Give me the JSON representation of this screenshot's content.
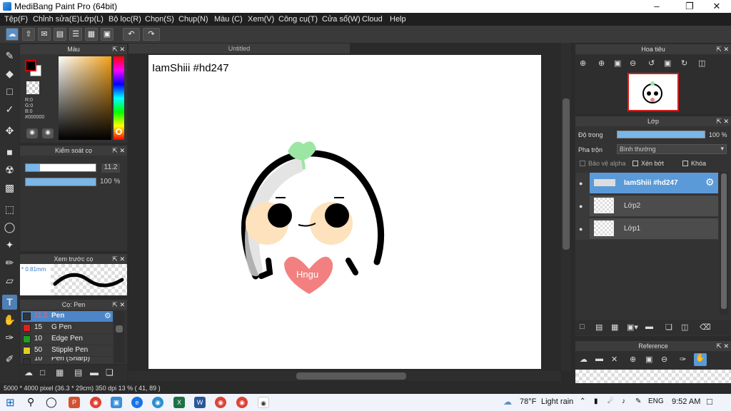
{
  "app": {
    "title": "MediBang Paint Pro (64bit)"
  },
  "menu": [
    "Tệp(F)",
    "Chỉnh sửa(E)",
    "Lớp(L)",
    "Bộ lọc(R)",
    "Chọn(S)",
    "Chụp(N)",
    "Màu (C)",
    "Xem(V)",
    "Công cụ(T)",
    "Cửa sổ(W)",
    "Cloud",
    "Help"
  ],
  "color_panel": {
    "title": "Màu",
    "r": "R:0",
    "g": "G:0",
    "b": "B:0",
    "hex": "#000000",
    "fg": "#000000",
    "bg": "#ffffff"
  },
  "brush_control": {
    "title": "Kiểm soát cọ",
    "size": "11.2",
    "opacity": "100 %",
    "size_fraction": 0.2,
    "opacity_fraction": 1.0
  },
  "brush_preview": {
    "title": "Xem trước cọ",
    "size_label": "* 0.81mm"
  },
  "brush_list": {
    "title": "Cọ: Pen",
    "items": [
      {
        "size": "11.2",
        "name": "Pen",
        "color": "#222222",
        "selected": true
      },
      {
        "size": "15",
        "name": "G Pen",
        "color": "#e02020",
        "selected": false
      },
      {
        "size": "10",
        "name": "Edge Pen",
        "color": "#20a020",
        "selected": false
      },
      {
        "size": "50",
        "name": "Stipple Pen",
        "color": "#e0d020",
        "selected": false
      },
      {
        "size": "10",
        "name": "Pen (Sharp)",
        "color": "#222222",
        "selected": false
      }
    ]
  },
  "canvas": {
    "tab": "Untitled",
    "text": "IamShiii #hd247",
    "heart_text": "Hngu"
  },
  "navigator": {
    "title": "Hoa tiêu"
  },
  "layers": {
    "title": "Lớp",
    "opacity_label": "Độ trong",
    "opacity_value": "100 %",
    "opacity_fraction": 1.0,
    "blend_label": "Pha trộn",
    "blend_value": "Bình thường",
    "protect_alpha": "Bảo vệ alpha",
    "clipping": "Xén bớt",
    "lock": "Khóa",
    "items": [
      {
        "name": "IamShiii #hd247",
        "selected": true
      },
      {
        "name": "Lớp2",
        "selected": false
      },
      {
        "name": "Lớp1",
        "selected": false
      }
    ]
  },
  "reference": {
    "title": "Reference"
  },
  "status": {
    "text": "5000 * 4000 pixel   (36.3 * 29cm)   350 dpi   13 %   ( 41, 89 )"
  },
  "taskbar": {
    "weather_temp": "78°F",
    "weather_desc": "Light rain",
    "lang": "ENG",
    "time": "9:52 AM"
  }
}
